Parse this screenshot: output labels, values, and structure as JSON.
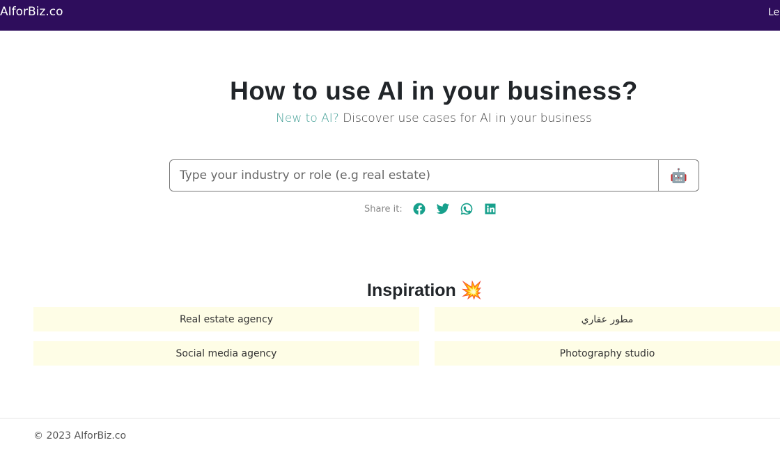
{
  "header": {
    "brand": "AIforBiz.co",
    "nav_link": "Le"
  },
  "hero": {
    "title": "How to use AI in your business?",
    "subtitle_highlight": "New to AI?",
    "subtitle_rest": " Discover use cases for AI in your business"
  },
  "search": {
    "placeholder": "Type your industry or role (e.g real estate)",
    "value": "",
    "button_icon": "robot-icon"
  },
  "share": {
    "label": "Share it:",
    "icons": [
      "facebook-icon",
      "twitter-icon",
      "whatsapp-icon",
      "linkedin-icon"
    ],
    "icon_color": "#17a08c"
  },
  "inspiration": {
    "title": "Inspiration",
    "emoji": "💥",
    "items": [
      "Real estate agency",
      "مطور عقاري",
      "Social media agency",
      "Photography studio"
    ]
  },
  "footer": {
    "copyright": "© 2023 AIforBiz.co"
  },
  "colors": {
    "header_bg": "#2e0d5c",
    "card_bg": "#fefde6",
    "accent": "#4aa39a"
  }
}
